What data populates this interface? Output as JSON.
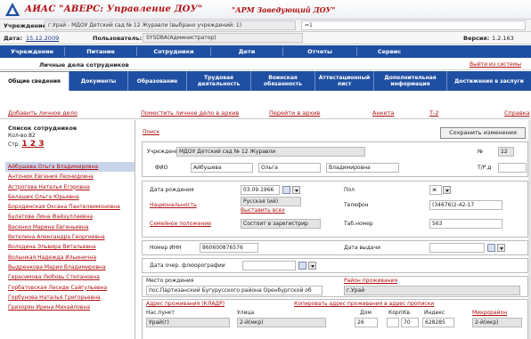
{
  "app": {
    "title": "АИАС \"АВЕРС: Управление ДОУ\"",
    "arm": "\"АРМ Заведующий ДОУ\""
  },
  "header": {
    "institution_label": "Учреждение:",
    "institution_value": "г.Урай - МДОУ Детский сад № 12 Журавли (выбрано учреждений: 1)",
    "right_value": "=1",
    "date_label": "Дата:",
    "date_value": "15.12.2009",
    "user_label": "Пользователь:",
    "user_value": "SYSDBA(Администратор)",
    "version_label": "Версия:",
    "version_value": "1.2.163"
  },
  "main_menu": [
    "Учреждение",
    "Питание",
    "Сотрудники",
    "Дети",
    "Отчеты",
    "Сервис"
  ],
  "page_title": "Личные дела сотрудников",
  "logout": "Выйти из системы",
  "tabs": [
    "Общие сведения",
    "Документы",
    "Образование",
    "Трудовая деятельность",
    "Воинская обязанность",
    "Аттестационный лист",
    "Дополнительная информация",
    "Достижения в заслуги"
  ],
  "actions": [
    "Добавить личное дело",
    "Поместить личное дело в архив",
    "Перейти в архив",
    "Анкета",
    "Т-2",
    "Справка"
  ],
  "sidebar": {
    "title": "Список сотрудников",
    "count": "Кол-во:82",
    "pages_label": "Стр.",
    "pages": "1 2 3",
    "employees": [
      "Айбушева Ольга Владимировна",
      "Антонюк Евгения Леонидовна",
      "Астрогова Наталья Егоровна",
      "Белаших Ольга Юрьевна",
      "Бородинская Оксана Пантелеимоновна",
      "Булатова Лина Файзуллаевна",
      "Васенко Марина Евгеньевна",
      "Ветелина Александра Георгиевна",
      "Володина Эльвира Витальевна",
      "Волынкая Надежда Ильинична",
      "Выдренкова Мария Владимировна",
      "Герасимова Любовь Степановна",
      "Горбатовская Лесиде Сайгульевна",
      "Горбунова Наталья Григорьевна",
      "Гризорян Ирина Михайловна"
    ]
  },
  "content": {
    "search": "Поиск",
    "save": "Сохранить изменения",
    "institution_label": "Учреждение",
    "institution_value": "МДОУ Детский сад № 12 Журавли",
    "num_label": "№",
    "num_value": "12",
    "fio_label": "ФИО",
    "last_name": "Айбушева",
    "first_name": "Ольга",
    "middle_name": "Владимировна",
    "tab_num_label": "Т/Р.д",
    "tab_num_value": "",
    "birth_label": "Дата рождения",
    "birth_value": "03.09.1966",
    "gender_label": "Пол",
    "gender_value": "ж",
    "nationality_label": "Национальность",
    "nationality_value": "Русская (ий)",
    "show_all": "Выставить всех",
    "phone_label": "Телефон",
    "phone_value": "(34676)2-42-17",
    "family_label": "Семейное положение",
    "family_value": "Состоит в зарегистрир",
    "tabnum_label": "Таб.номер",
    "tabnum_value": "563",
    "inn_label": "Номер ИНН",
    "inn_value": "860600876576",
    "issue_label": "Дата выдачи",
    "issue_value": "",
    "fluoro_label": "Дата очер. флюорографии",
    "birthplace_label": "Место рождения",
    "birthplace_value": "пос.Партизанский Бугурусского района Оренбургской об",
    "region_label": "Район проживания",
    "region_value": "г.Урай",
    "address_reg": "Адрес проживания (КЛАДР)",
    "copy_address": "Копировать адрес проживания в адрес прописки",
    "city_label": "Нас.пункт",
    "city_value": "Урай(г)",
    "street_label": "Улица",
    "street_value": "2-й(мкр)",
    "house_label": "Дом",
    "house_value": "26",
    "korp_label": "Корп.",
    "korp_value": "",
    "kv_label": "Кв.",
    "kv_value": "70",
    "index_label": "Индекс",
    "index_value": "628285",
    "micro_label": "Микрорайон",
    "micro_value": "2-й(мкр)"
  },
  "colors": {
    "menu_bg": "#1e4fa3",
    "title_red": "#b01010",
    "selected": "#c9d5ea"
  }
}
